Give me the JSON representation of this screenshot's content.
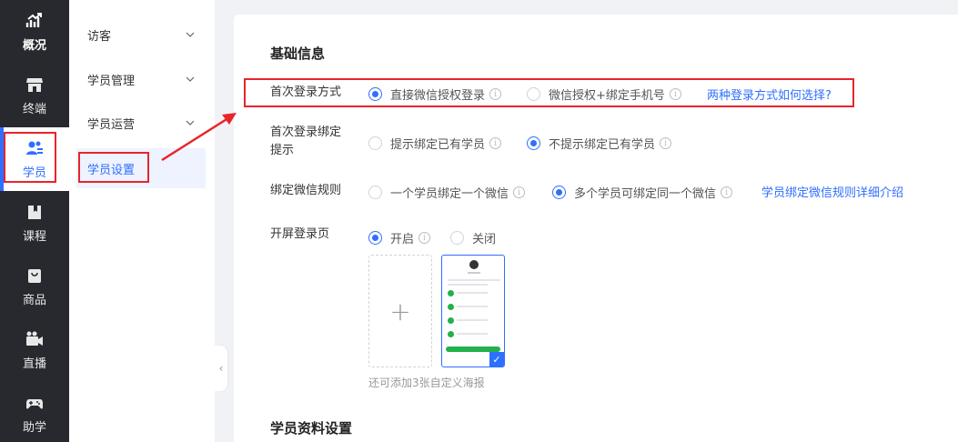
{
  "nav": {
    "items": [
      {
        "label": "概况",
        "icon": "chart-trend-icon"
      },
      {
        "label": "终端",
        "icon": "store-icon"
      },
      {
        "label": "学员",
        "icon": "users-icon"
      },
      {
        "label": "课程",
        "icon": "book-icon"
      },
      {
        "label": "商品",
        "icon": "bag-icon"
      },
      {
        "label": "直播",
        "icon": "video-camera-icon"
      },
      {
        "label": "助学",
        "icon": "gamepad-icon"
      }
    ]
  },
  "submenu": {
    "items": [
      {
        "label": "访客"
      },
      {
        "label": "学员管理"
      },
      {
        "label": "学员运营"
      },
      {
        "label": "学员设置"
      }
    ]
  },
  "main": {
    "section_basic": "基础信息",
    "section_profile": "学员资料设置",
    "rows": {
      "first_login": {
        "label": "首次登录方式",
        "option1": "直接微信授权登录",
        "option2": "微信授权+绑定手机号",
        "link": "两种登录方式如何选择?"
      },
      "bind_prompt": {
        "label_line1": "首次登录绑定",
        "label_line2": "提示",
        "option1": "提示绑定已有学员",
        "option2": "不提示绑定已有学员"
      },
      "wechat_rule": {
        "label": "绑定微信规则",
        "option1": "一个学员绑定一个微信",
        "option2": "多个学员可绑定同一个微信",
        "link": "学员绑定微信规则详细介绍"
      },
      "splash": {
        "label": "开屏登录页",
        "option1": "开启",
        "option2": "关闭",
        "add_symbol": "+",
        "hint": "还可添加3张自定义海报"
      }
    }
  },
  "collapse_glyph": "‹",
  "colors": {
    "accent": "#2f6fff",
    "nav_bg": "#28292e",
    "annotation_red": "#e8242b"
  }
}
